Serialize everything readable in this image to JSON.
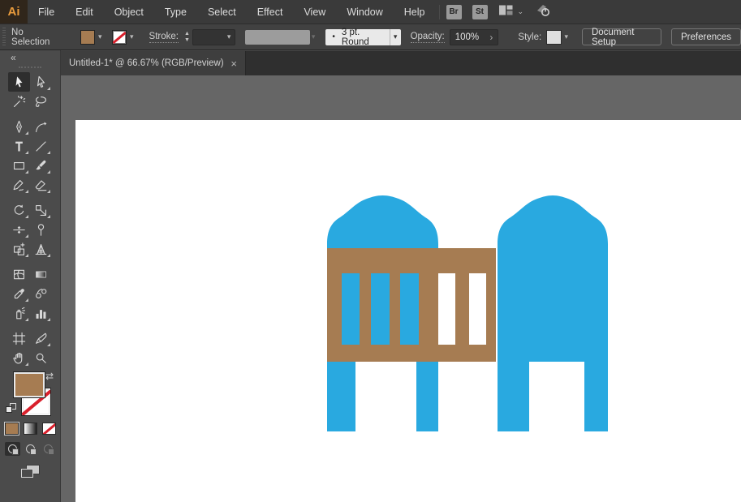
{
  "app": {
    "logo": "Ai",
    "bridge_label": "Br",
    "stock_label": "St"
  },
  "menu": {
    "items": [
      "File",
      "Edit",
      "Object",
      "Type",
      "Select",
      "Effect",
      "View",
      "Window",
      "Help"
    ]
  },
  "control_bar": {
    "selection_status": "No Selection",
    "stroke_label": "Stroke:",
    "stepper_up": "▲",
    "stepper_down": "▼",
    "chevron_glyph": "▾",
    "brush_bullet": "•",
    "brush_name": "3 pt. Round",
    "opacity_label": "Opacity:",
    "opacity_value": "100%",
    "opacity_popout_glyph": "›",
    "style_label": "Style:",
    "document_setup_button": "Document Setup",
    "preferences_button": "Preferences"
  },
  "tab": {
    "title": "Untitled-1* @ 66.67% (RGB/Preview)",
    "close_glyph": "×"
  },
  "toolbar": {
    "collapse_glyph": "«",
    "swap_glyph": "⇄",
    "tools": [
      {
        "name": "selection-tool",
        "selected": true,
        "flyout": false
      },
      {
        "name": "direct-selection-tool",
        "flyout": true
      },
      {
        "name": "magic-wand-tool",
        "flyout": false
      },
      {
        "name": "lasso-tool",
        "flyout": false
      },
      {
        "name": "pen-tool",
        "flyout": true
      },
      {
        "name": "curvature-tool",
        "flyout": false
      },
      {
        "name": "type-tool",
        "flyout": true
      },
      {
        "name": "line-segment-tool",
        "flyout": true
      },
      {
        "name": "rectangle-tool",
        "flyout": true
      },
      {
        "name": "paintbrush-tool",
        "flyout": true
      },
      {
        "name": "shaper-tool",
        "flyout": true
      },
      {
        "name": "eraser-tool",
        "flyout": true
      },
      {
        "name": "rotate-tool",
        "flyout": true
      },
      {
        "name": "scale-tool",
        "flyout": true
      },
      {
        "name": "width-tool",
        "flyout": true
      },
      {
        "name": "puppet-warp-tool",
        "flyout": false
      },
      {
        "name": "shape-builder-tool",
        "flyout": true
      },
      {
        "name": "perspective-grid-tool",
        "flyout": true
      },
      {
        "name": "mesh-tool",
        "flyout": false
      },
      {
        "name": "gradient-tool",
        "flyout": false
      },
      {
        "name": "eyedropper-tool",
        "flyout": true
      },
      {
        "name": "blend-tool",
        "flyout": false
      },
      {
        "name": "symbol-sprayer-tool",
        "flyout": true
      },
      {
        "name": "column-graph-tool",
        "flyout": true
      },
      {
        "name": "artboard-tool",
        "flyout": false
      },
      {
        "name": "slice-tool",
        "flyout": true
      },
      {
        "name": "hand-tool",
        "flyout": true
      },
      {
        "name": "zoom-tool",
        "flyout": false
      }
    ]
  },
  "colors": {
    "fill_swatch": "#A67C52",
    "artwork_blue": "#29A9E0",
    "artwork_brown": "#A67C52",
    "none_red": "#D9202C",
    "logo_orange": "#E89B3C",
    "logo_bg": "#30261B"
  }
}
